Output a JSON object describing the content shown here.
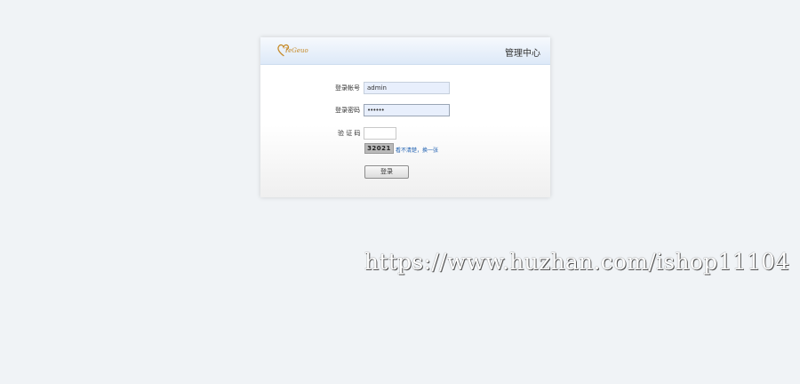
{
  "header": {
    "logo_text": "TeGeuo",
    "title": "管理中心"
  },
  "form": {
    "username_label": "登录帐号",
    "username_value": "admin",
    "password_label": "登录密码",
    "password_value": "••••••",
    "captcha_label": "验 证 码",
    "captcha_value": "",
    "captcha_image_text": "32021",
    "refresh_link": "看不清楚，换一张",
    "login_button": "登录"
  },
  "watermark": "https://www.huzhan.com/ishop11104",
  "colors": {
    "page_background": "#f0f3f6",
    "header_gradient_bottom": "#dde9f8",
    "input_fill": "#e8effc",
    "link": "#1d5fb0",
    "logo": "#c68a28"
  },
  "icons": {
    "logo": "heart-logo-icon"
  }
}
